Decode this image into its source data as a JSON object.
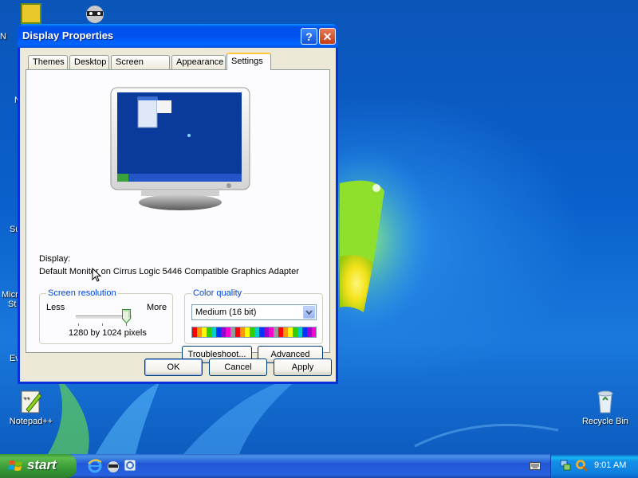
{
  "desktop": {
    "icons": [
      {
        "label": "Notepad++"
      },
      {
        "label": "Recycle Bin"
      }
    ],
    "partial_labels": [
      "N",
      "N",
      "Su",
      "Micr",
      "St",
      "Ev"
    ]
  },
  "window": {
    "title": "Display Properties",
    "help_glyph": "?",
    "close_glyph": "✕",
    "tabs": [
      {
        "label": "Themes"
      },
      {
        "label": "Desktop"
      },
      {
        "label": "Screen Saver"
      },
      {
        "label": "Appearance"
      },
      {
        "label": "Settings"
      }
    ],
    "active_tab": "Settings",
    "display_label": "Display:",
    "display_value": "Default Monitor on Cirrus Logic 5446 Compatible Graphics Adapter",
    "resolution": {
      "title": "Screen resolution",
      "less": "Less",
      "more": "More",
      "value": "1280 by 1024 pixels",
      "slider_position": 1.0
    },
    "color_quality": {
      "title": "Color quality",
      "selected": "Medium (16 bit)"
    },
    "buttons": {
      "troubleshoot": "Troubleshoot...",
      "advanced": "Advanced",
      "ok": "OK",
      "cancel": "Cancel",
      "apply": "Apply"
    }
  },
  "taskbar": {
    "start_label": "start",
    "clock": "9:01 AM"
  },
  "colors": {
    "titlebar": "#0053ee",
    "group_title": "#0046d5",
    "start_green": "#379a37"
  }
}
